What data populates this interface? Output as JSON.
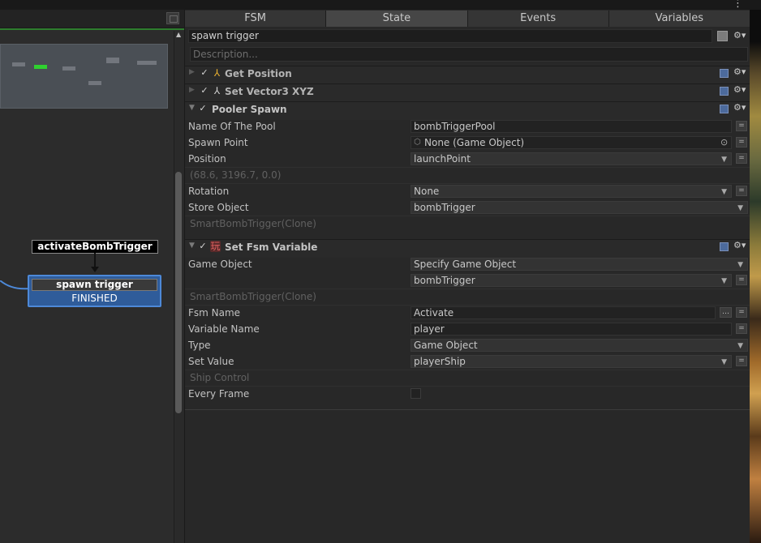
{
  "graph": {
    "node_label": "activateBombTrigger",
    "state_title": "spawn trigger",
    "state_event": "FINISHED"
  },
  "tabs": [
    "FSM",
    "State",
    "Events",
    "Variables"
  ],
  "active_tab": "State",
  "state": {
    "name": "spawn trigger",
    "description_placeholder": "Description..."
  },
  "actions": [
    {
      "title": "Get Position",
      "expanded": false,
      "icon": "transform-axes-icon"
    },
    {
      "title": "Set Vector3 XYZ",
      "expanded": false,
      "icon": "vector-axes-icon"
    },
    {
      "title": "Pooler Spawn",
      "expanded": true,
      "fields": {
        "name_of_pool_label": "Name Of The Pool",
        "name_of_pool": "bombTriggerPool",
        "spawn_point_label": "Spawn Point",
        "spawn_point": "None (Game Object)",
        "position_label": "Position",
        "position": "launchPoint",
        "position_value": "(68.6, 3196.7, 0.0)",
        "rotation_label": "Rotation",
        "rotation": "None",
        "store_object_label": "Store Object",
        "store_object": "bombTrigger",
        "store_object_value": "SmartBombTrigger(Clone)"
      }
    },
    {
      "title": "Set Fsm Variable",
      "expanded": true,
      "icon": "playmaker-icon",
      "fields": {
        "game_object_label": "Game Object",
        "game_object_mode": "Specify Game Object",
        "game_object": "bombTrigger",
        "game_object_value": "SmartBombTrigger(Clone)",
        "fsm_name_label": "Fsm Name",
        "fsm_name": "Activate",
        "variable_name_label": "Variable Name",
        "variable_name": "player",
        "type_label": "Type",
        "type": "Game Object",
        "set_value_label": "Set Value",
        "set_value": "playerShip",
        "set_value_value": "Ship Control",
        "every_frame_label": "Every Frame"
      }
    }
  ],
  "colors": {
    "selection_blue": "#2f5c9a",
    "accent_green": "#2c7a2c"
  }
}
